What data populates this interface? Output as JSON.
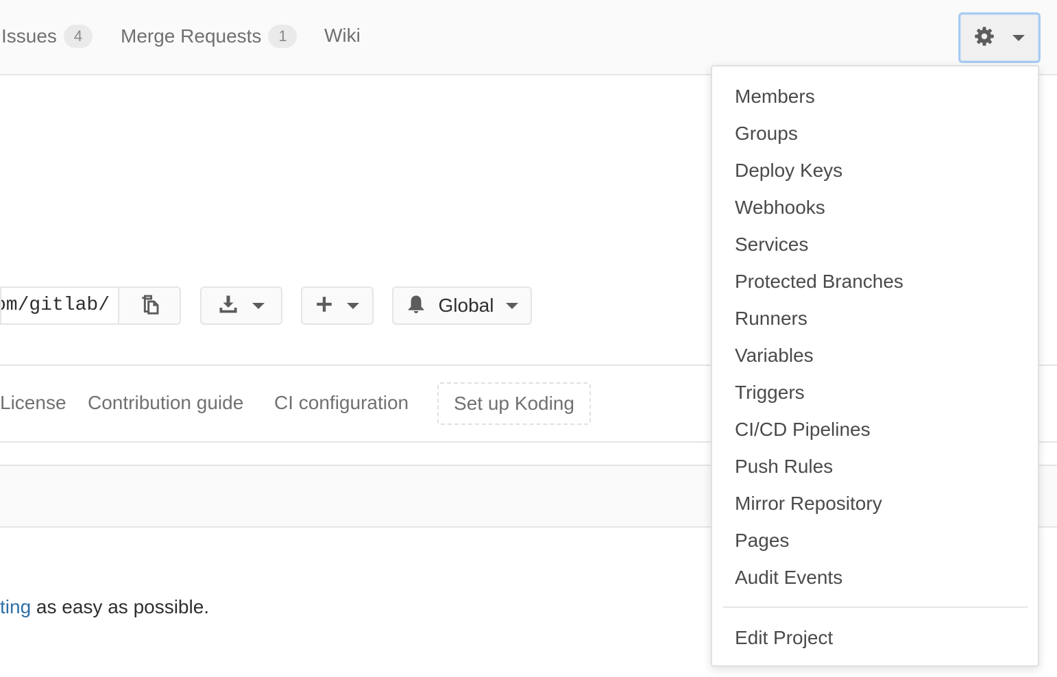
{
  "nav": {
    "issues": {
      "label": "Issues",
      "count": "4"
    },
    "merge_requests": {
      "label": "Merge Requests",
      "count": "1"
    },
    "wiki": {
      "label": "Wiki"
    }
  },
  "clone": {
    "url": "https://gitlab.com/gitlab/"
  },
  "notification": {
    "level": "Global"
  },
  "quick_links": [
    "License",
    "Contribution guide",
    "CI configuration"
  ],
  "koding_label": "Set up Koding",
  "readme": {
    "link_text": "ting",
    "text": " as easy as possible."
  },
  "settings_menu": {
    "items": [
      "Members",
      "Groups",
      "Deploy Keys",
      "Webhooks",
      "Services",
      "Protected Branches",
      "Runners",
      "Variables",
      "Triggers",
      "CI/CD Pipelines",
      "Push Rules",
      "Mirror Repository",
      "Pages",
      "Audit Events"
    ],
    "footer_item": "Edit Project"
  },
  "icons": [
    "gear-icon",
    "chevron-down-icon",
    "clipboard-icon",
    "download-icon",
    "plus-icon",
    "bell-icon"
  ]
}
